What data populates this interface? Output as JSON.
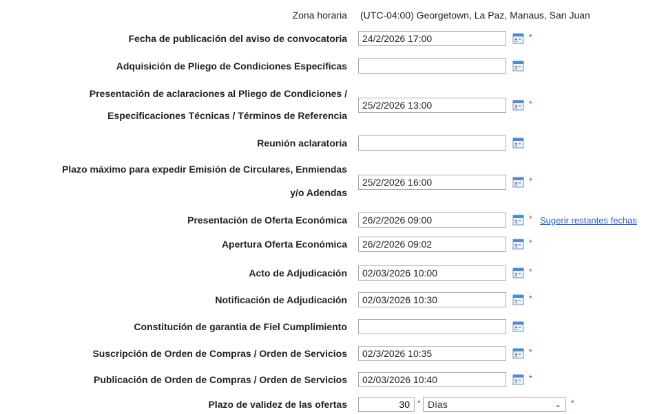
{
  "timezone": {
    "label": "Zona horaria",
    "value": "(UTC-04:00) Georgetown, La Paz, Manaus, San Juan"
  },
  "rows": [
    {
      "label": "Fecha de publicación del aviso de convocatoria",
      "value": "24/2/2026 17:00",
      "required_mark": "*"
    },
    {
      "label": "Adquisición de Pliego de Condiciones Específicas",
      "value": "",
      "required_mark": ""
    },
    {
      "label_line1": "Presentación de aclaraciones al Pliego de Condiciones /",
      "label_line2": "Especificaciones Técnicas / Términos de Referencia",
      "value": "25/2/2026 13:00",
      "required_mark": "*"
    },
    {
      "label": "Reunión aclaratoria",
      "value": "",
      "required_mark": ""
    },
    {
      "label_line1": "Plazo máximo para expedir Emisión de Circulares, Enmiendas",
      "label_line2": "y/o Adendas",
      "value": "25/2/2026 16:00",
      "required_mark": "*"
    },
    {
      "label": "Presentación de Oferta Económica",
      "value": "26/2/2026 09:00",
      "required_mark": "*",
      "link": "Sugerir restantes fechas"
    },
    {
      "label": "Apertura Oferta Económica",
      "value": "26/2/2026 09:02",
      "required_mark": "*"
    },
    {
      "label": "Acto de Adjudicación",
      "value": "02/03/2026 10:00",
      "required_mark": "*"
    },
    {
      "label": "Notificación de Adjudicación",
      "value": "02/03/2026 10:30",
      "required_mark": "*"
    },
    {
      "label": "Constitución de garantia de Fiel Cumplimiento",
      "value": "",
      "required_mark": ""
    },
    {
      "label": "Suscripción de Orden de Compras / Orden de Servicios",
      "value": "02/3/2026 10:35",
      "required_mark": "*"
    },
    {
      "label": "Publicación de Orden de Compras / Orden de Servicios",
      "value": "02/03/2026 10:40",
      "required_mark": "*"
    }
  ],
  "validity": {
    "label": "Plazo de validez de las ofertas",
    "number": "30",
    "required_mark": "*",
    "unit_selected": "Días",
    "unit_required_mark": "*"
  },
  "icons": {
    "calendar": "calendar-icon",
    "dropdown": "chevron-down-icon"
  },
  "colors": {
    "required": "#dd2222",
    "link": "#1f5fc8"
  }
}
